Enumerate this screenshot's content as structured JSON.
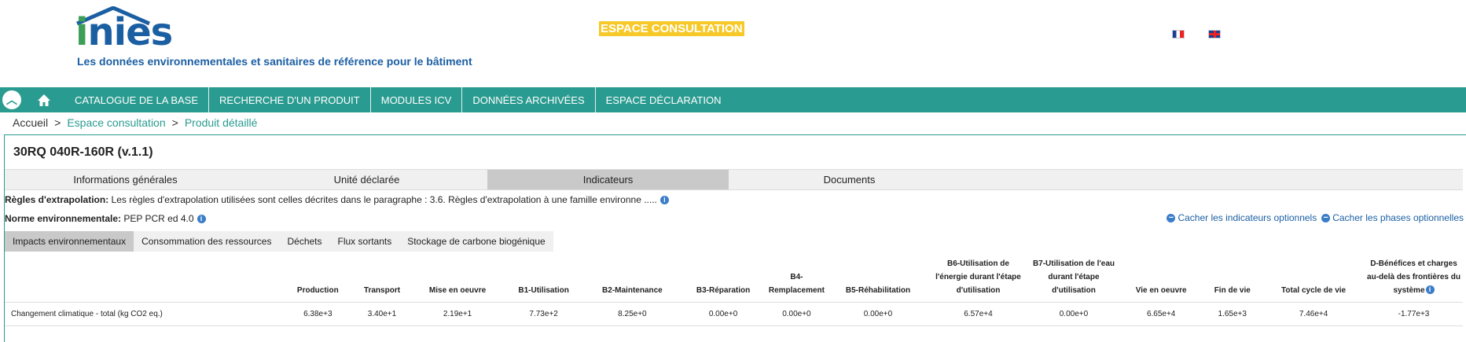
{
  "header": {
    "logo_text_i": "i",
    "logo_text_rest": "nies",
    "tagline": "Les données environnementales et sanitaires de référence pour le bâtiment",
    "banner": "ESPACE CONSULTATION",
    "colors": {
      "teal": "#2a9b90",
      "blue": "#1b5fa3",
      "green": "#3c9f57",
      "yellow": "#f6c928"
    }
  },
  "nav": {
    "items": [
      "CATALOGUE DE LA BASE",
      "RECHERCHE D'UN PRODUIT",
      "MODULES ICV",
      "DONNÉES ARCHIVÉES",
      "ESPACE DÉCLARATION"
    ]
  },
  "breadcrumb": {
    "home": "Accueil",
    "sep": ">",
    "level1": "Espace consultation",
    "level2": "Produit détaillé"
  },
  "product": {
    "title": "30RQ 040R-160R (v.1.1)",
    "tabs": [
      "Informations générales",
      "Unité déclarée",
      "Indicateurs",
      "Documents"
    ],
    "active_tab": "Indicateurs",
    "extrapolation_label": "Règles d'extrapolation:",
    "extrapolation_text": " Les règles d'extrapolation utilisées sont celles décrites dans le paragraphe : 3.6. Règles d'extrapolation à une famille environne .....",
    "norme_label": "Norme environnementale:",
    "norme_text": " PEP PCR ed 4.0",
    "toggle_indicateurs": "Cacher les indicateurs optionnels",
    "toggle_phases": "Cacher les phases optionnelles",
    "subtabs": [
      "Impacts environnementaux",
      "Consommation des ressources",
      "Déchets",
      "Flux sortants",
      "Stockage de carbone biogénique"
    ],
    "active_subtab": "Impacts environnementaux"
  },
  "table": {
    "columns": [
      "Production",
      "Transport",
      "Mise en oeuvre",
      "B1-Utilisation",
      "B2-Maintenance",
      "B3-Réparation",
      "B4-Remplacement",
      "B5-Réhabilitation",
      "B6-Utilisation de l'énergie durant l'étape d'utilisation",
      "B7-Utilisation de l'eau durant l'étape d'utilisation",
      "Vie en oeuvre",
      "Fin de vie",
      "Total cycle de vie",
      "D-Bénéfices et charges au-delà des frontières du système"
    ],
    "rows": [
      {
        "label": "Changement climatique - total (kg CO2 eq.)",
        "values": [
          "6.38e+3",
          "3.40e+1",
          "2.19e+1",
          "7.73e+2",
          "8.25e+0",
          "0.00e+0",
          "0.00e+0",
          "0.00e+0",
          "6.57e+4",
          "0.00e+0",
          "6.65e+4",
          "1.65e+3",
          "7.46e+4",
          "-1.77e+3"
        ]
      }
    ]
  }
}
